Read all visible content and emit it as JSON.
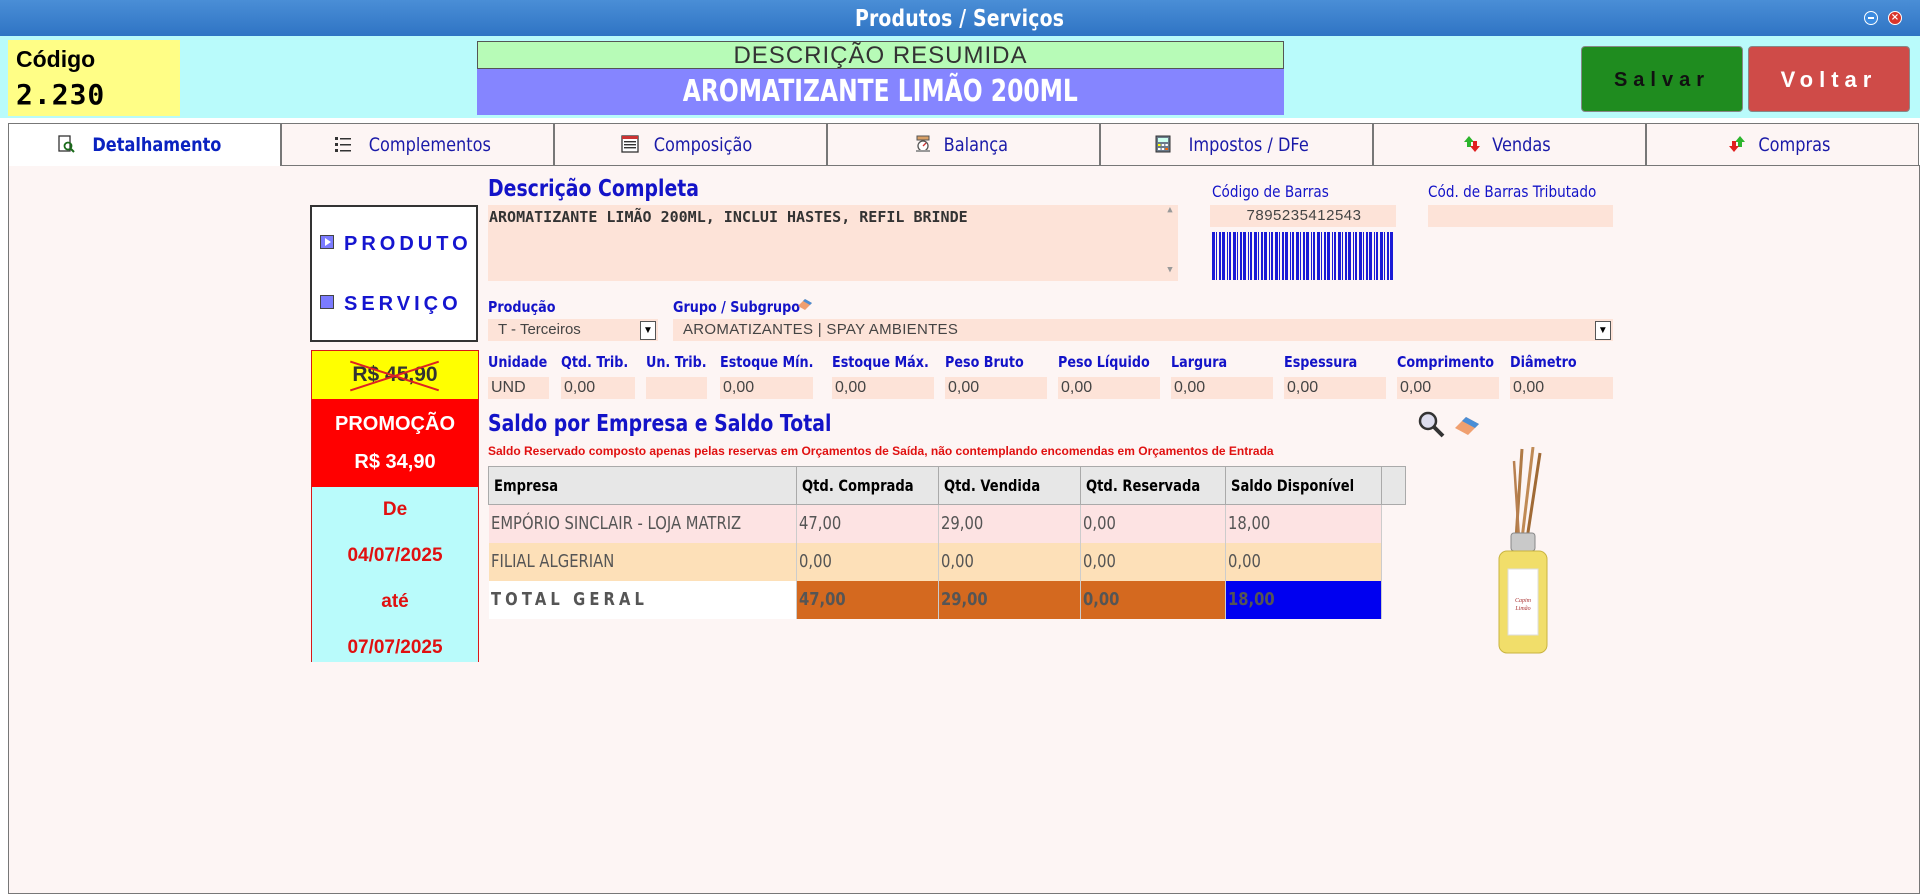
{
  "window": {
    "title": "Produtos / Serviços"
  },
  "header": {
    "code_label": "Código",
    "code_value": "2.230",
    "desc_res_label": "DESCRIÇÃO RESUMIDA",
    "desc_res_value": "AROMATIZANTE LIMÃO 200ML",
    "save_label": "Salvar",
    "back_label": "Voltar"
  },
  "tabs": [
    {
      "label": "Detalhamento",
      "icon": "search-doc-icon"
    },
    {
      "label": "Complementos",
      "icon": "list-icon"
    },
    {
      "label": "Composição",
      "icon": "composition-icon"
    },
    {
      "label": "Balança",
      "icon": "scale-icon"
    },
    {
      "label": "Impostos / DFe",
      "icon": "calculator-icon"
    },
    {
      "label": "Vendas",
      "icon": "up-down-arrows-icon"
    },
    {
      "label": "Compras",
      "icon": "up-down-arrows-icon"
    }
  ],
  "type": {
    "produto": "PRODUTO",
    "servico": "SERVIÇO",
    "selected": "PRODUTO"
  },
  "promo": {
    "old_price": "R$ 45,90",
    "label": "PROMOÇÃO",
    "price": "R$ 34,90",
    "from_label": "De",
    "from_date": "04/07/2025",
    "to_label": "até",
    "to_date": "07/07/2025"
  },
  "description": {
    "title": "Descrição Completa",
    "text": "AROMATIZANTE LIMÃO 200ML, INCLUI HASTES, REFIL BRINDE"
  },
  "barcode": {
    "label": "Código de Barras",
    "value": "7895235412543",
    "taxed_label": "Cód. de Barras Tributado",
    "taxed_value": ""
  },
  "production": {
    "label": "Produção",
    "value": "T - Terceiros"
  },
  "group": {
    "label": "Grupo / Subgrupo",
    "value": "AROMATIZANTES | SPAY AMBIENTES"
  },
  "specs": [
    {
      "label": "Unidade",
      "value": "UND"
    },
    {
      "label": "Qtd. Trib.",
      "value": "0,00"
    },
    {
      "label": "Un. Trib.",
      "value": ""
    },
    {
      "label": "Estoque Mín.",
      "value": "0,00"
    },
    {
      "label": "Estoque Máx.",
      "value": "0,00"
    },
    {
      "label": "Peso Bruto",
      "value": "0,00"
    },
    {
      "label": "Peso Líquido",
      "value": "0,00"
    },
    {
      "label": "Largura",
      "value": "0,00"
    },
    {
      "label": "Espessura",
      "value": "0,00"
    },
    {
      "label": "Comprimento",
      "value": "0,00"
    },
    {
      "label": "Diâmetro",
      "value": "0,00"
    }
  ],
  "saldo": {
    "title": "Saldo por Empresa e Saldo Total",
    "note": "Saldo Reservado composto apenas pelas reservas em Orçamentos de Saída, não contemplando encomendas em Orçamentos de Entrada",
    "columns": [
      "Empresa",
      "Qtd. Comprada",
      "Qtd. Vendida",
      "Qtd. Reservada",
      "Saldo Disponível"
    ],
    "rows": [
      [
        "EMPÓRIO SINCLAIR - LOJA MATRIZ",
        "47,00",
        "29,00",
        "0,00",
        "18,00"
      ],
      [
        "FILIAL ALGERIAN",
        "0,00",
        "0,00",
        "0,00",
        "0,00"
      ]
    ],
    "total": [
      "TOTAL GERAL",
      "47,00",
      "29,00",
      "0,00",
      "18,00"
    ]
  },
  "colors": {
    "titlebar": "#2f74c4",
    "header_bg": "#b9fbfb",
    "save": "#1f8c1f",
    "back": "#cf4b48",
    "accent_blue": "#1313c8",
    "promo_red": "#ff0000"
  }
}
